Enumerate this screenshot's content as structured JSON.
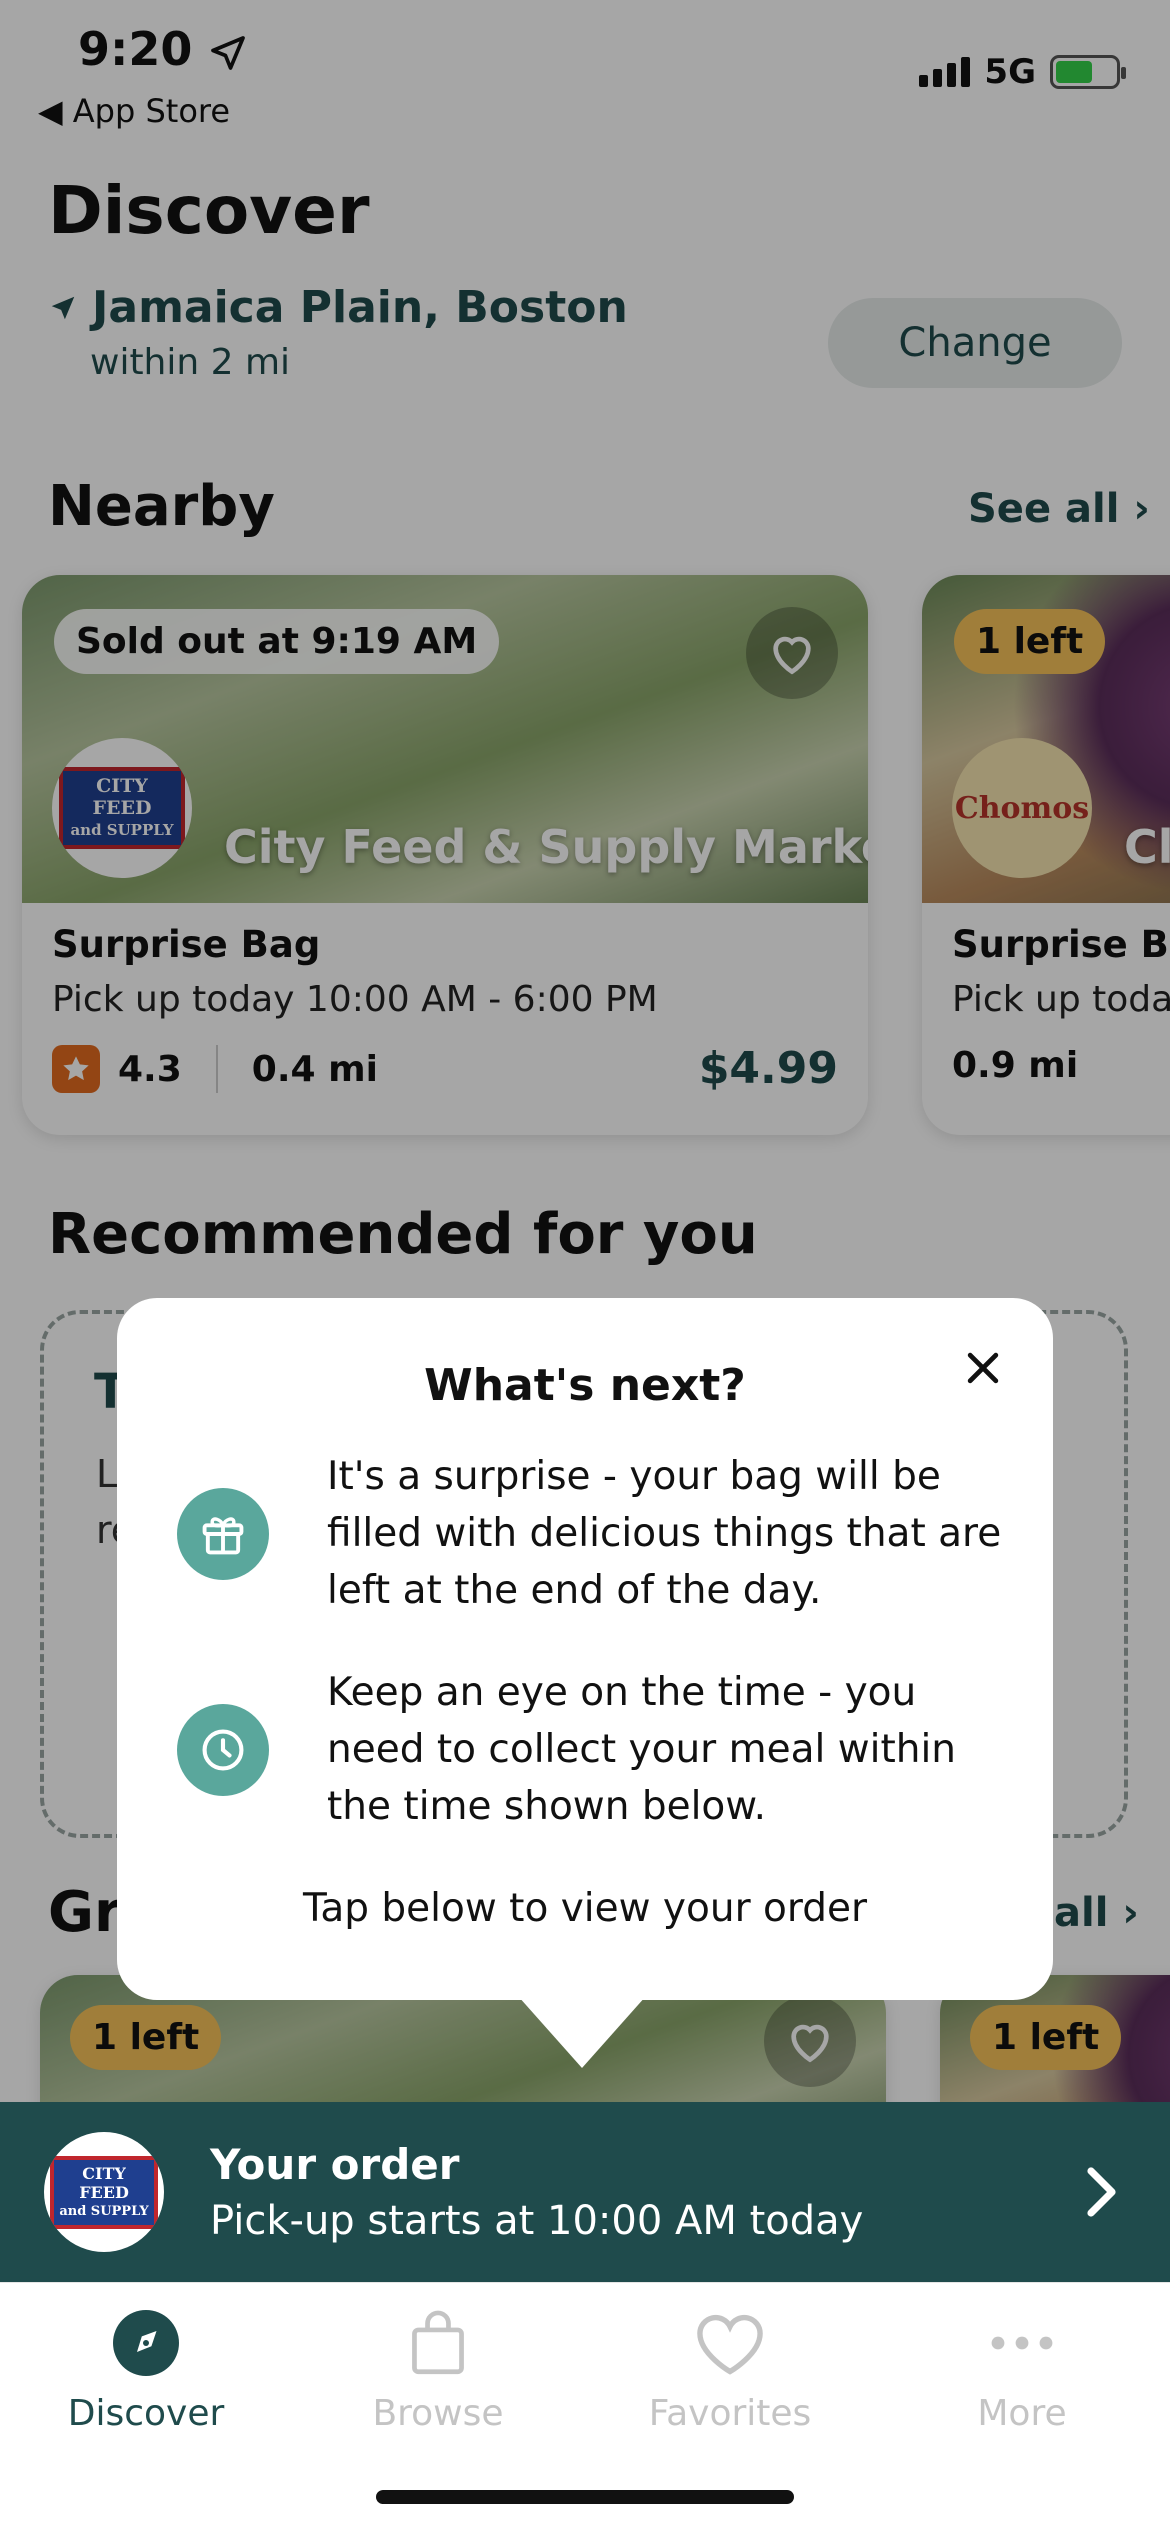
{
  "status_bar": {
    "time": "9:20",
    "back_label": "App Store",
    "network": "5G"
  },
  "header": {
    "title": "Discover",
    "location": "Jamaica Plain, Boston",
    "radius": "within 2 mi",
    "change_label": "Change"
  },
  "nearby": {
    "title": "Nearby",
    "see_all": "See all",
    "cards": [
      {
        "badge": "Sold out at 9:19 AM",
        "store": "City Feed & Supply Market",
        "logo_text": [
          "CITY FEED",
          "and SUPPLY"
        ],
        "bag": "Surprise Bag",
        "pickup": "Pick up today 10:00 AM - 6:00 PM",
        "rating": "4.3",
        "distance": "0.4 mi",
        "price": "$4.99"
      },
      {
        "badge": "1 left",
        "store": "Cl",
        "logo_text": [
          "Chomos"
        ],
        "bag": "Surprise Bag",
        "pickup": "Pick up today",
        "distance": "0.9 mi"
      }
    ]
  },
  "recommended": {
    "title": "Recommended for you",
    "peek_title": "T",
    "peek_lines": [
      "L",
      "re"
    ]
  },
  "grocery": {
    "title_peek": "Gr",
    "see_all_peek": "all",
    "badges": [
      "1 left",
      "1 left"
    ]
  },
  "modal": {
    "title": "What's next?",
    "items": [
      {
        "icon": "gift-icon",
        "text": "It's a surprise - your bag will be filled with delicious things that are left at the end of the day."
      },
      {
        "icon": "clock-icon",
        "text": "Keep an eye on the time - you need to collect your meal within the time shown below."
      }
    ],
    "footer": "Tap below to view your order"
  },
  "order": {
    "title": "Your order",
    "subtitle": "Pick-up starts at 10:00 AM today",
    "logo_text": [
      "CITY FEED",
      "and SUPPLY"
    ]
  },
  "tabs": [
    {
      "label": "Discover",
      "icon": "compass-icon",
      "active": true
    },
    {
      "label": "Browse",
      "icon": "bag-icon",
      "active": false
    },
    {
      "label": "Favorites",
      "icon": "heart-icon",
      "active": false
    },
    {
      "label": "More",
      "icon": "more-icon",
      "active": false
    }
  ],
  "colors": {
    "brand": "#1f4b4c",
    "accent": "#5aa79c",
    "badge_yellow": "#f6c25a",
    "star": "#e26b1f"
  }
}
